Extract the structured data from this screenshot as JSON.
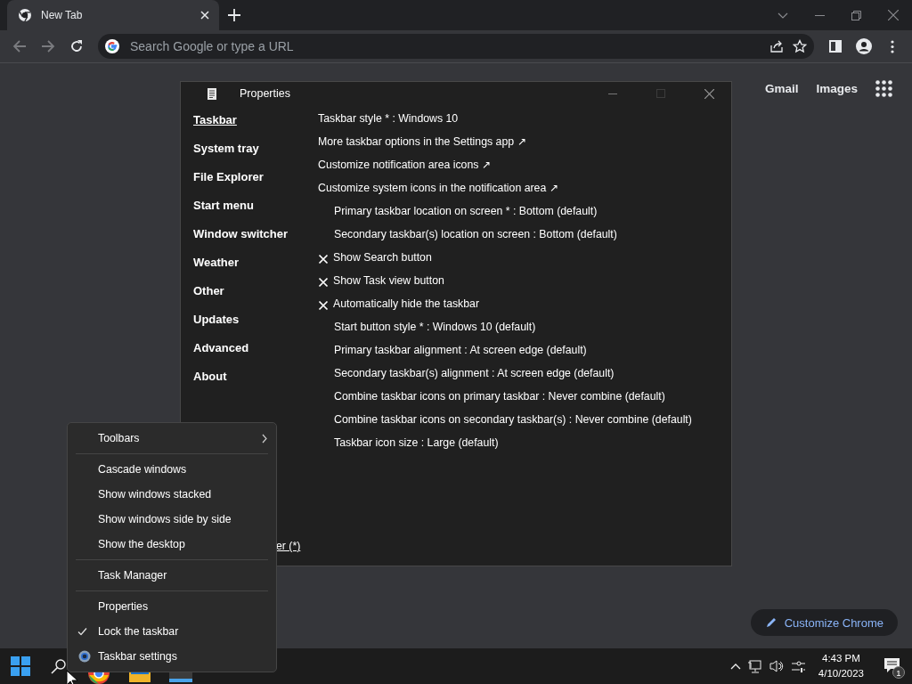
{
  "browser": {
    "tab": {
      "title": "New Tab",
      "selected": true
    },
    "back": {
      "disabled": true
    },
    "forward": {
      "disabled": true
    },
    "omnibox": {
      "placeholder": "Search Google or type a URL"
    }
  },
  "new_tab_page": {
    "links": [
      "Gmail",
      "Images"
    ],
    "customize_button": "Customize Chrome"
  },
  "properties_window": {
    "title": "Properties",
    "sidebar": [
      {
        "label": "Taskbar",
        "selected": true
      },
      {
        "label": "System tray",
        "selected": false
      },
      {
        "label": "File Explorer",
        "selected": false
      },
      {
        "label": "Start menu",
        "selected": false
      },
      {
        "label": "Window switcher",
        "selected": false
      },
      {
        "label": "Weather",
        "selected": false
      },
      {
        "label": "Other",
        "selected": false
      },
      {
        "label": "Updates",
        "selected": false
      },
      {
        "label": "Advanced",
        "selected": false
      },
      {
        "label": "About",
        "selected": false
      }
    ],
    "footer_link": "er (*)",
    "settings": [
      {
        "kind": "setting",
        "text": "Taskbar style * : Windows 10"
      },
      {
        "kind": "link",
        "text": "More taskbar options in the Settings app ↗"
      },
      {
        "kind": "link",
        "text": "Customize notification area icons ↗"
      },
      {
        "kind": "link",
        "text": "Customize system icons in the notification area ↗"
      },
      {
        "kind": "option",
        "text": "Primary taskbar location on screen * : Bottom (default)"
      },
      {
        "kind": "option",
        "text": "Secondary taskbar(s) location on screen : Bottom (default)"
      },
      {
        "kind": "toggle",
        "checked": false,
        "text": "Show Search button"
      },
      {
        "kind": "toggle",
        "checked": false,
        "text": "Show Task view button"
      },
      {
        "kind": "toggle",
        "checked": false,
        "text": "Automatically hide the taskbar"
      },
      {
        "kind": "option",
        "text": "Start button style * : Windows 10 (default)"
      },
      {
        "kind": "option",
        "text": "Primary taskbar alignment : At screen edge (default)"
      },
      {
        "kind": "option",
        "text": "Secondary taskbar(s) alignment : At screen edge (default)"
      },
      {
        "kind": "option",
        "text": "Combine taskbar icons on primary taskbar : Never combine (default)"
      },
      {
        "kind": "option",
        "text": "Combine taskbar icons on secondary taskbar(s) : Never combine (default)"
      },
      {
        "kind": "option",
        "text": "Taskbar icon size : Large (default)"
      }
    ]
  },
  "context_menu": {
    "groups": [
      [
        {
          "kind": "submenu",
          "label": "Toolbars",
          "checked": false
        }
      ],
      [
        {
          "kind": "command",
          "label": "Cascade windows",
          "checked": false
        },
        {
          "kind": "command",
          "label": "Show windows stacked",
          "checked": false
        },
        {
          "kind": "command",
          "label": "Show windows side by side",
          "checked": false
        },
        {
          "kind": "command",
          "label": "Show the desktop",
          "checked": false
        }
      ],
      [
        {
          "kind": "command",
          "label": "Task Manager",
          "checked": false
        }
      ],
      [
        {
          "kind": "command",
          "label": "Properties",
          "checked": false
        },
        {
          "kind": "command",
          "label": "Lock the taskbar",
          "checked": true
        },
        {
          "kind": "settings",
          "label": "Taskbar settings",
          "checked": false
        }
      ]
    ]
  },
  "taskbar": {
    "time": "4:43 PM",
    "date": "4/10/2023",
    "notification_count": "1"
  }
}
